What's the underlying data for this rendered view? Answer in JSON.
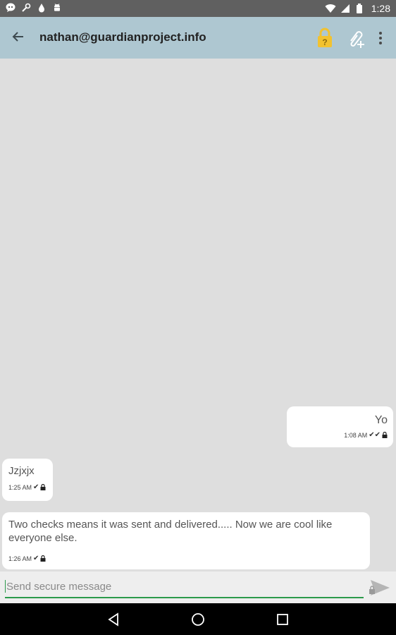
{
  "status_bar": {
    "time": "1:28",
    "icons": [
      "chat-bubble-icon",
      "wrench-icon",
      "water-drop-icon",
      "android-icon",
      "wifi-icon",
      "signal-icon",
      "battery-icon"
    ]
  },
  "app_bar": {
    "back_icon": "arrow-back-icon",
    "title": "nathan@guardianproject.info",
    "actions": [
      "lock-unverified-icon",
      "attach-add-icon",
      "overflow-menu-icon"
    ],
    "colors": {
      "background": "#aec7d1",
      "lock": "#f2c230"
    }
  },
  "messages": [
    {
      "direction": "outgoing",
      "text": "Yo",
      "time": "1:08 AM",
      "status": "double-check",
      "encrypted": true
    },
    {
      "direction": "incoming",
      "text": "Jzjxjx",
      "time": "1:25 AM",
      "status": "check",
      "encrypted": true
    },
    {
      "direction": "incoming",
      "text": "Two checks means it was sent and delivered..... Now we are cool like everyone else.",
      "time": "1:26 AM",
      "status": "check",
      "encrypted": true
    }
  ],
  "composer": {
    "placeholder": "Send secure message",
    "value": "",
    "send_icon": "send-icon",
    "accent": "#2b9a4b"
  },
  "nav_bar": {
    "icons": [
      "nav-back-icon",
      "nav-home-icon",
      "nav-recents-icon"
    ]
  }
}
